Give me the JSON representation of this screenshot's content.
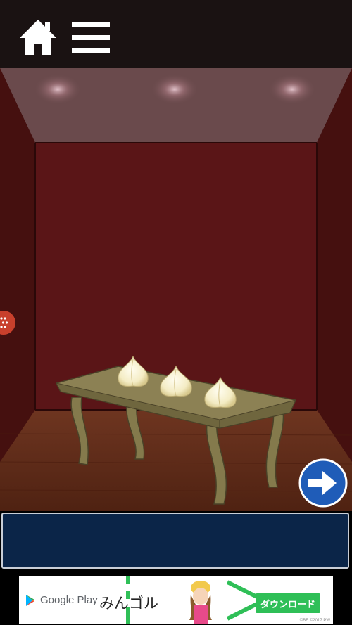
{
  "ad": {
    "store_label": "Google Play",
    "app_name": "みんゴル",
    "download_label": "ダウンロード",
    "copyright": "©BE ©2017 PW"
  },
  "colors": {
    "topbar": "#1a1212",
    "wall": "#5a1517",
    "floor": "#5e2a18",
    "message_bg": "#0b2548",
    "nav_button": "#1f5cb8"
  },
  "icons": {
    "home": "home-icon",
    "menu": "menu-icon",
    "next": "arrow-right-icon",
    "side": "side-tab-icon"
  },
  "scene": {
    "items_on_table": 3
  }
}
